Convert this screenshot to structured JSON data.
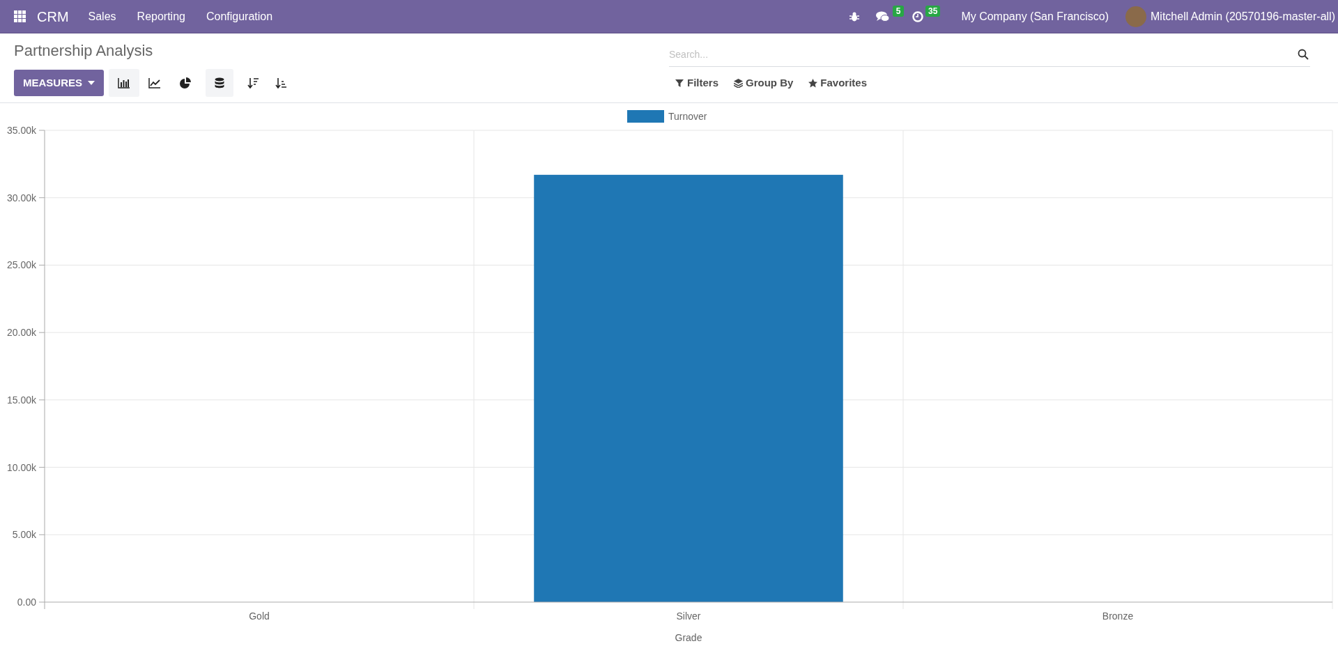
{
  "navbar": {
    "app": "CRM",
    "menu": [
      "Sales",
      "Reporting",
      "Configuration"
    ],
    "messages_count": "5",
    "activities_count": "35",
    "company": "My Company (San Francisco)",
    "user": "Mitchell Admin (20570196-master-all)"
  },
  "control_panel": {
    "title": "Partnership Analysis",
    "measures_button": "MEASURES",
    "chart_types": [
      {
        "kind": "bar",
        "selected": true
      },
      {
        "kind": "line",
        "selected": false
      },
      {
        "kind": "pie",
        "selected": false
      }
    ],
    "stacked": true,
    "search": {
      "placeholder": "Search..."
    },
    "search_options": [
      {
        "kind": "filter",
        "label": "Filters"
      },
      {
        "kind": "group",
        "label": "Group By"
      },
      {
        "kind": "favorite",
        "label": "Favorites"
      }
    ]
  },
  "chart_data": {
    "type": "bar",
    "grid": true,
    "xlabel": "Grade",
    "categories": [
      "Gold",
      "Silver",
      "Bronze"
    ],
    "series": [
      {
        "name": "Turnover",
        "color": "#1f77b4",
        "values": [
          0,
          31700,
          0
        ]
      }
    ],
    "ylim": [
      0,
      35000
    ],
    "yticks": [
      {
        "value": 0,
        "label": "0.00"
      },
      {
        "value": 5000,
        "label": "5.00k"
      },
      {
        "value": 10000,
        "label": "10.00k"
      },
      {
        "value": 15000,
        "label": "15.00k"
      },
      {
        "value": 20000,
        "label": "20.00k"
      },
      {
        "value": 25000,
        "label": "25.00k"
      },
      {
        "value": 30000,
        "label": "30.00k"
      },
      {
        "value": 35000,
        "label": "35.00k"
      }
    ]
  }
}
